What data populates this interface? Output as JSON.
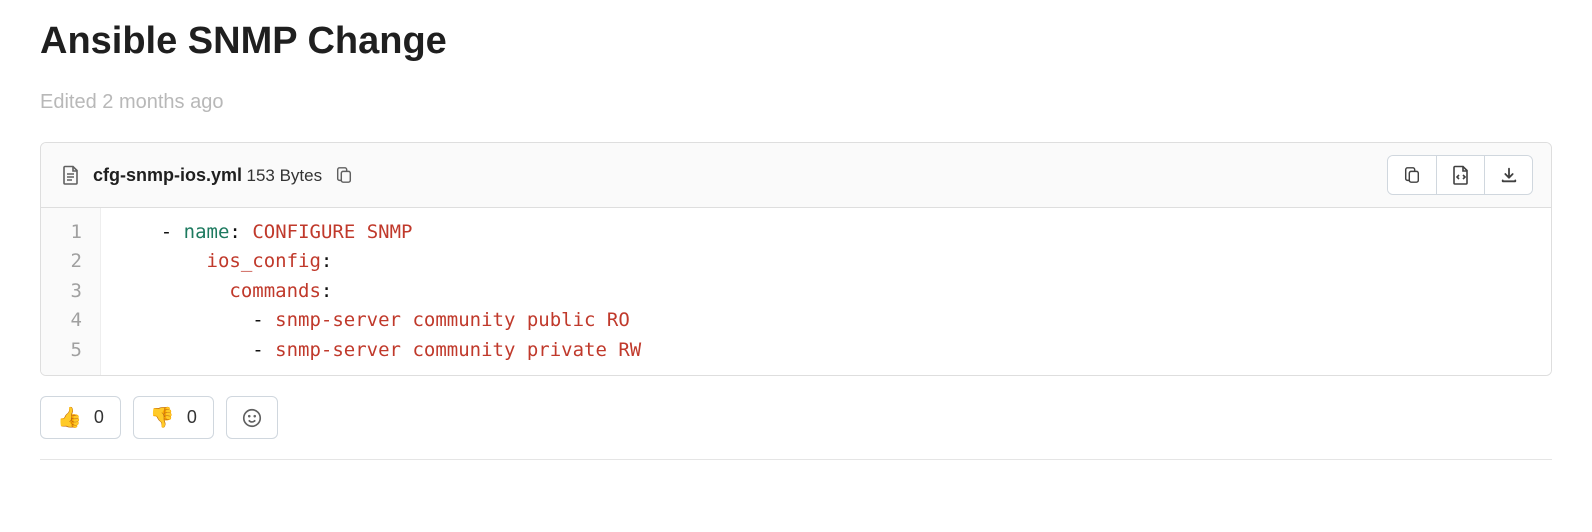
{
  "title": "Ansible SNMP Change",
  "edited": "Edited 2 months ago",
  "file": {
    "name": "cfg-snmp-ios.yml",
    "size": "153 Bytes"
  },
  "code": {
    "line_numbers": [
      "1",
      "2",
      "3",
      "4",
      "5"
    ],
    "lines": [
      {
        "indent": "    ",
        "tokens": [
          {
            "t": "- ",
            "c": "tok-punc"
          },
          {
            "t": "name",
            "c": "tok-key"
          },
          {
            "t": ": ",
            "c": "tok-punc"
          },
          {
            "t": "CONFIGURE SNMP",
            "c": "tok-str"
          }
        ]
      },
      {
        "indent": "        ",
        "tokens": [
          {
            "t": "ios_config",
            "c": "tok-str"
          },
          {
            "t": ":",
            "c": "tok-punc"
          }
        ]
      },
      {
        "indent": "          ",
        "tokens": [
          {
            "t": "commands",
            "c": "tok-str"
          },
          {
            "t": ":",
            "c": "tok-punc"
          }
        ]
      },
      {
        "indent": "            ",
        "tokens": [
          {
            "t": "- ",
            "c": "tok-punc"
          },
          {
            "t": "snmp-server community public RO",
            "c": "tok-str"
          }
        ]
      },
      {
        "indent": "            ",
        "tokens": [
          {
            "t": "- ",
            "c": "tok-punc"
          },
          {
            "t": "snmp-server community private RW",
            "c": "tok-str"
          }
        ]
      }
    ]
  },
  "reactions": {
    "thumbs_up": {
      "emoji": "👍",
      "count": "0"
    },
    "thumbs_down": {
      "emoji": "👎",
      "count": "0"
    }
  }
}
